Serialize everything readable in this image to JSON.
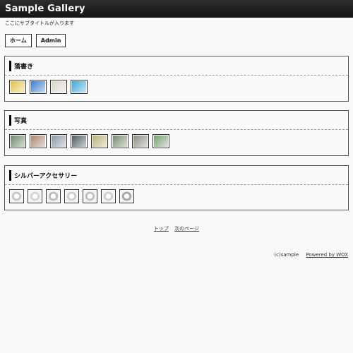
{
  "header": {
    "title": "Sample Gallery"
  },
  "subtitle": "ここにサブタイトルが入ります",
  "nav": {
    "home_label": "ホーム",
    "admin_label": "Admin"
  },
  "sections": [
    {
      "title": "落書き",
      "thumbs": [
        {
          "name": "doodle-thumb-1",
          "color": "#e7c24e"
        },
        {
          "name": "doodle-thumb-2",
          "color": "#3b7fd4"
        },
        {
          "name": "doodle-thumb-3",
          "color": "#d9d3c8"
        },
        {
          "name": "doodle-thumb-4",
          "color": "#3fa9d9"
        }
      ]
    },
    {
      "title": "写真",
      "thumbs": [
        {
          "name": "photo-thumb-1",
          "color": "#6b8a6a"
        },
        {
          "name": "photo-thumb-2",
          "color": "#a88670"
        },
        {
          "name": "photo-thumb-3",
          "color": "#8a96a6"
        },
        {
          "name": "photo-thumb-4",
          "color": "#4e5a5e"
        },
        {
          "name": "photo-thumb-5",
          "color": "#b8b27a"
        },
        {
          "name": "photo-thumb-6",
          "color": "#7a8a70"
        },
        {
          "name": "photo-thumb-7",
          "color": "#8c8c84"
        },
        {
          "name": "photo-thumb-8",
          "color": "#76a070"
        }
      ]
    },
    {
      "title": "シルバーアクセサリー",
      "thumbs": [
        {
          "name": "silver-thumb-1",
          "color": "#c8c8c8"
        },
        {
          "name": "silver-thumb-2",
          "color": "#d4d4d4"
        },
        {
          "name": "silver-thumb-3",
          "color": "#bdbdbd"
        },
        {
          "name": "silver-thumb-4",
          "color": "#cfcfcf"
        },
        {
          "name": "silver-thumb-5",
          "color": "#c2c2c2"
        },
        {
          "name": "silver-thumb-6",
          "color": "#d0d0d0"
        },
        {
          "name": "silver-thumb-7",
          "color": "#a9a9a9"
        }
      ]
    }
  ],
  "pager": {
    "top_label": "トップ",
    "next_label": "次のページ"
  },
  "footer": {
    "copyright": "(c)sample",
    "powered_by": "Powered by WOX"
  }
}
